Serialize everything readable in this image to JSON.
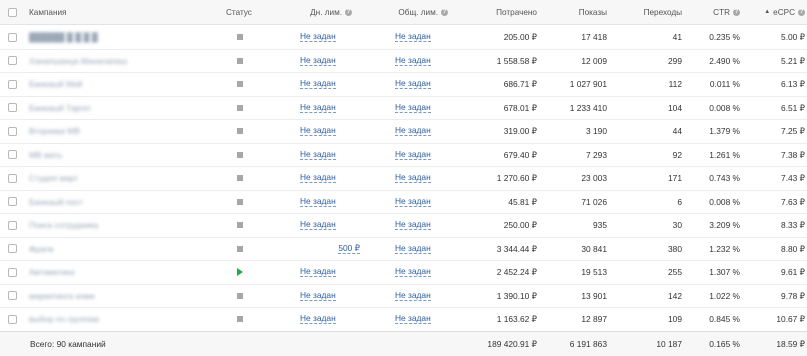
{
  "header": {
    "campaign": "Кампания",
    "status": "Статус",
    "day_limit": "Дн. лим.",
    "total_limit": "Общ. лим.",
    "spent": "Потрачено",
    "shows": "Показы",
    "clicks": "Переходы",
    "ctr": "CTR",
    "ecpc": "eCPC",
    "help_glyph": "?",
    "sort_glyph": "▲"
  },
  "rows": [
    {
      "name": "██████ █ █ █ █",
      "status": "stopped",
      "day_limit": "Не задан",
      "total_limit": "Не задан",
      "spent": "205.00 ₽",
      "shows": "17 418",
      "clicks": "41",
      "ctr": "0.235 %",
      "ecpc": "5.00 ₽"
    },
    {
      "name": "Ханапшанца Маналапаш",
      "status": "stopped",
      "day_limit": "Не задан",
      "total_limit": "Не задан",
      "spent": "1 558.58 ₽",
      "shows": "12 009",
      "clicks": "299",
      "ctr": "2.490 %",
      "ecpc": "5.21 ₽"
    },
    {
      "name": "Банкашй Мий",
      "status": "stopped",
      "day_limit": "Не задан",
      "total_limit": "Не задан",
      "spent": "686.71 ₽",
      "shows": "1 027 901",
      "clicks": "112",
      "ctr": "0.011 %",
      "ecpc": "6.13 ₽"
    },
    {
      "name": "Банкашй Таргет",
      "status": "stopped",
      "day_limit": "Не задан",
      "total_limit": "Не задан",
      "spent": "678.01 ₽",
      "shows": "1 233 410",
      "clicks": "104",
      "ctr": "0.008 %",
      "ecpc": "6.51 ₽"
    },
    {
      "name": "Вторники МВ",
      "status": "stopped",
      "day_limit": "Не задан",
      "total_limit": "Не задан",
      "spent": "319.00 ₽",
      "shows": "3 190",
      "clicks": "44",
      "ctr": "1.379 %",
      "ecpc": "7.25 ₽"
    },
    {
      "name": "МВ мать",
      "status": "stopped",
      "day_limit": "Не задан",
      "total_limit": "Не задан",
      "spent": "679.40 ₽",
      "shows": "7 293",
      "clicks": "92",
      "ctr": "1.261 %",
      "ecpc": "7.38 ₽"
    },
    {
      "name": "Студия март",
      "status": "stopped",
      "day_limit": "Не задан",
      "total_limit": "Не задан",
      "spent": "1 270.60 ₽",
      "shows": "23 003",
      "clicks": "171",
      "ctr": "0.743 %",
      "ecpc": "7.43 ₽"
    },
    {
      "name": "Банкашй пост",
      "status": "stopped",
      "day_limit": "Не задан",
      "total_limit": "Не задан",
      "spent": "45.81 ₽",
      "shows": "71 026",
      "clicks": "6",
      "ctr": "0.008 %",
      "ecpc": "7.63 ₽"
    },
    {
      "name": "Поиск сотрудника",
      "status": "stopped",
      "day_limit": "Не задан",
      "total_limit": "Не задан",
      "spent": "250.00 ₽",
      "shows": "935",
      "clicks": "30",
      "ctr": "3.209 %",
      "ecpc": "8.33 ₽"
    },
    {
      "name": "Фрагм",
      "status": "stopped",
      "day_limit": "500 ₽",
      "total_limit": "Не задан",
      "spent": "3 344.44 ₽",
      "shows": "30 841",
      "clicks": "380",
      "ctr": "1.232 %",
      "ecpc": "8.80 ₽"
    },
    {
      "name": "Автоматика",
      "status": "running",
      "day_limit": "Не задан",
      "total_limit": "Не задан",
      "spent": "2 452.24 ₽",
      "shows": "19 513",
      "clicks": "255",
      "ctr": "1.307 %",
      "ecpc": "9.61 ₽"
    },
    {
      "name": "маркетинга номе",
      "status": "stopped",
      "day_limit": "Не задан",
      "total_limit": "Не задан",
      "spent": "1 390.10 ₽",
      "shows": "13 901",
      "clicks": "142",
      "ctr": "1.022 %",
      "ecpc": "9.78 ₽"
    },
    {
      "name": "выбор по группам",
      "status": "stopped",
      "day_limit": "Не задан",
      "total_limit": "Не задан",
      "spent": "1 163.62 ₽",
      "shows": "12 897",
      "clicks": "109",
      "ctr": "0.845 %",
      "ecpc": "10.67 ₽"
    }
  ],
  "footer": {
    "total_label": "Всего: 90 кампаний",
    "spent": "189 420.91 ₽",
    "shows": "6 191 863",
    "clicks": "10 187",
    "ctr": "0.165 %",
    "ecpc": "18.59 ₽"
  },
  "colors": {
    "link": "#2f5f9d",
    "running": "#27a844",
    "stopped": "#a7a7a7"
  }
}
